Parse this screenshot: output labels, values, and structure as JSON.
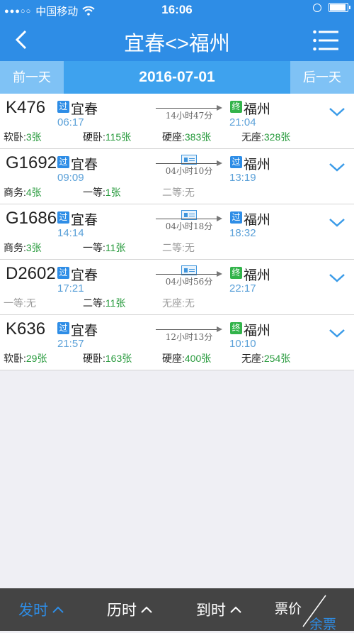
{
  "status_bar": {
    "carrier": "中国移动",
    "time": "16:06"
  },
  "nav": {
    "title": "宜春<>福州",
    "back_icon": "chevron-left-icon",
    "menu_icon": "list-menu-icon"
  },
  "date_bar": {
    "prev_label": "前一天",
    "date": "2016-07-01",
    "next_label": "后一天"
  },
  "trains": [
    {
      "number": "K476",
      "dep_tag": "过",
      "dep_tag_color": "blue",
      "dep_station": "宜春",
      "dep_time": "06:17",
      "duration": "14小时47分",
      "id_icon": false,
      "arr_tag": "终",
      "arr_tag_color": "green",
      "arr_station": "福州",
      "arr_time": "21:04",
      "seats": [
        {
          "label": "软卧:",
          "count": "3张",
          "available": true
        },
        {
          "label": "硬卧:",
          "count": "115张",
          "available": true
        },
        {
          "label": "硬座:",
          "count": "383张",
          "available": true
        },
        {
          "label": "无座:",
          "count": "328张",
          "available": true
        }
      ]
    },
    {
      "number": "G1692",
      "dep_tag": "过",
      "dep_tag_color": "blue",
      "dep_station": "宜春",
      "dep_time": "09:09",
      "duration": "04小时10分",
      "id_icon": true,
      "arr_tag": "过",
      "arr_tag_color": "blue",
      "arr_station": "福州",
      "arr_time": "13:19",
      "seats": [
        {
          "label": "商务:",
          "count": "4张",
          "available": true
        },
        {
          "label": "一等:",
          "count": "1张",
          "available": true
        },
        {
          "label": "二等:",
          "count": "无",
          "available": false
        }
      ]
    },
    {
      "number": "G1686",
      "dep_tag": "过",
      "dep_tag_color": "blue",
      "dep_station": "宜春",
      "dep_time": "14:14",
      "duration": "04小时18分",
      "id_icon": true,
      "arr_tag": "过",
      "arr_tag_color": "blue",
      "arr_station": "福州",
      "arr_time": "18:32",
      "seats": [
        {
          "label": "商务:",
          "count": "3张",
          "available": true
        },
        {
          "label": "一等:",
          "count": "11张",
          "available": true
        },
        {
          "label": "二等:",
          "count": "无",
          "available": false
        }
      ]
    },
    {
      "number": "D2602",
      "dep_tag": "过",
      "dep_tag_color": "blue",
      "dep_station": "宜春",
      "dep_time": "17:21",
      "duration": "04小时56分",
      "id_icon": true,
      "arr_tag": "终",
      "arr_tag_color": "green",
      "arr_station": "福州",
      "arr_time": "22:17",
      "seats": [
        {
          "label": "一等:",
          "count": "无",
          "available": false
        },
        {
          "label": "二等:",
          "count": "11张",
          "available": true
        },
        {
          "label": "无座:",
          "count": "无",
          "available": false
        }
      ]
    },
    {
      "number": "K636",
      "dep_tag": "过",
      "dep_tag_color": "blue",
      "dep_station": "宜春",
      "dep_time": "21:57",
      "duration": "12小时13分",
      "id_icon": false,
      "arr_tag": "终",
      "arr_tag_color": "green",
      "arr_station": "福州",
      "arr_time": "10:10",
      "seats": [
        {
          "label": "软卧:",
          "count": "29张",
          "available": true
        },
        {
          "label": "硬卧:",
          "count": "163张",
          "available": true
        },
        {
          "label": "硬座:",
          "count": "400张",
          "available": true
        },
        {
          "label": "无座:",
          "count": "254张",
          "available": true
        }
      ]
    }
  ],
  "tab_bar": {
    "depart_label": "发时",
    "duration_label": "历时",
    "arrive_label": "到时",
    "price_label": "票价",
    "remain_label": "余票",
    "active_color": "#2e8de6"
  }
}
